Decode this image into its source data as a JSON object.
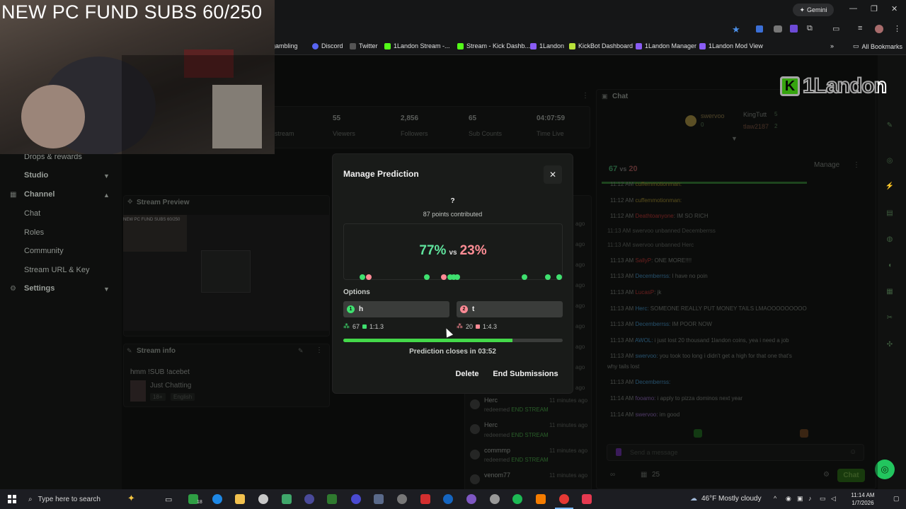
{
  "browser": {
    "gemini_label": "Gemini",
    "bookmarks": [
      "gambling",
      "Discord",
      "Twitter",
      "1Landon Stream -...",
      "Stream - Kick Dashb...",
      "1Landon",
      "KickBot Dashboard",
      "1Landon Manager",
      "1Landon Mod View"
    ],
    "all_bookmarks": "All Bookmarks"
  },
  "overlay": {
    "title": "NEW PC FUND SUBS 60/250",
    "logo_text": "1Landon"
  },
  "sidebar": {
    "items": [
      {
        "label": "Drops & rewards",
        "kind": "item"
      },
      {
        "label": "Studio",
        "kind": "group"
      },
      {
        "label": "Channel",
        "kind": "group"
      },
      {
        "label": "Chat",
        "kind": "sub"
      },
      {
        "label": "Roles",
        "kind": "sub"
      },
      {
        "label": "Community",
        "kind": "sub"
      },
      {
        "label": "Stream URL & Key",
        "kind": "sub"
      },
      {
        "label": "Settings",
        "kind": "group"
      }
    ]
  },
  "stats": [
    {
      "value": "55",
      "label": "Viewers"
    },
    {
      "value": "2,856",
      "label": "Followers"
    },
    {
      "value": "65",
      "label": "Sub Counts"
    },
    {
      "value": "04:07:59",
      "label": "Time Live"
    }
  ],
  "stats_partial_label": "stream",
  "panels": {
    "preview_title": "Stream Preview",
    "preview_overlay": "NEW PC FUND SUBS 60/250",
    "info_title": "Stream info",
    "info_text": "hmm !SUB !acebet",
    "category": "Just Chatting",
    "tags": [
      "18+",
      "English"
    ]
  },
  "activity": [
    {
      "name": "Herc",
      "action": "redeemed",
      "reward": "END STREAM",
      "ago": "11 minutes ago"
    },
    {
      "name": "Herc",
      "action": "redeemed",
      "reward": "END STREAM",
      "ago": "11 minutes ago"
    },
    {
      "name": "commmp",
      "action": "redeemed",
      "reward": "END STREAM",
      "ago": "11 minutes ago"
    },
    {
      "name": "venom77",
      "action": "",
      "reward": "",
      "ago": "11 minutes ago"
    }
  ],
  "activity_ago_short": "ago",
  "chat": {
    "title": "Chat",
    "manage": "Manage",
    "leaders": [
      "swervoo",
      "KingTutt",
      "tlaw2187"
    ],
    "leader_counts": [
      "0",
      "5",
      "2"
    ],
    "mini_pred": {
      "left": "67",
      "vs": "vs",
      "right": "20"
    },
    "lines": [
      {
        "time": "11:12 AM",
        "user": "cuffemmotionman:",
        "msg": ""
      },
      {
        "time": "11:12 AM",
        "user": "cuffemmotionman:",
        "msg": ""
      },
      {
        "time": "11:12 AM",
        "user": "Deathtoanyone",
        "msg": ": IM SO RICH"
      },
      {
        "time": "11:13 AM",
        "user": "swervoo",
        "msg": " unbanned Decemberrss"
      },
      {
        "time": "11:13 AM",
        "user": "swervoo",
        "msg": " unbanned Herc"
      },
      {
        "time": "11:13 AM",
        "user": "SallyP",
        "msg": ": ONE MORE!!!!"
      },
      {
        "time": "11:13 AM",
        "user": "Decemberrss:",
        "msg": " I have no poin"
      },
      {
        "time": "11:13 AM",
        "user": "LucasP",
        "msg": ": jk"
      },
      {
        "time": "11:13 AM",
        "user": "Herc:",
        "msg": " SOMEONE REALLY PUT MONEY TAILS LMAOOOOOOOOO"
      },
      {
        "time": "11:13 AM",
        "user": "Decemberrss:",
        "msg": " IM POOR NOW"
      },
      {
        "time": "11:13 AM",
        "user": "AWOL:",
        "msg": " i just lost 20 thousand 1landon coins, yea i need a job"
      },
      {
        "time": "11:13 AM",
        "user": "swervoo:",
        "msg": " you took too long i didn't get a high for that one that's"
      },
      {
        "time": "",
        "user": "",
        "msg": "why tails lost"
      },
      {
        "time": "11:13 AM",
        "user": "Decemberrss:",
        "msg": ""
      },
      {
        "time": "11:14 AM",
        "user": "fooamo:",
        "msg": " i apply to pizza dominos next year"
      },
      {
        "time": "11:14 AM",
        "user": "swervoo:",
        "msg": " im good"
      }
    ],
    "input_placeholder": "Send a message",
    "viewer_count": "25",
    "chat_button": "Chat"
  },
  "modal": {
    "title": "Manage Prediction",
    "close_label": "✕",
    "question": "?",
    "points": "87 points contributed",
    "pct_left": "77%",
    "vs": "vs",
    "pct_right": "23%",
    "options_label": "Options",
    "options": [
      {
        "num": "1",
        "label": "h",
        "count": "67",
        "ratio": "1:1.3",
        "color": "#3fe06f"
      },
      {
        "num": "2",
        "label": "t",
        "count": "20",
        "ratio": "1:4.3",
        "color": "#ff8a95"
      }
    ],
    "progress": 0.77,
    "closes": "Prediction closes in 03:52",
    "delete_label": "Delete",
    "end_label": "End Submissions"
  },
  "taskbar": {
    "search_placeholder": "Type here to search",
    "weather": "46°F  Mostly cloudy",
    "time": "11:14 AM",
    "date": "1/7/2026",
    "badge": "18"
  }
}
